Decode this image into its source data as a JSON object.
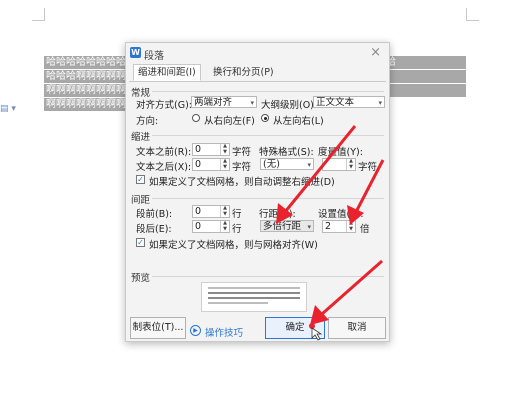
{
  "document": {
    "lines": [
      "哈哈哈哈哈哈哈哈哈哈哈哈哈哈哈哈哈哈哈哈哈哈哈哈哈哈哈哈哈哈哈哈哈哈哈",
      "哈哈哈啊啊啊啊啊啊啊啊啊啊啊啊啊啊啊啊啊啊啊啊啊啊啊啊哈哈哈哈哈哈哈",
      "啊啊啊啊啊啊啊啊啊啊啊啊啊啊啊啊啊啊啊啊啊啊啊啊啊哦哦或哦或哦或哦",
      "啊啊啊啊啊啊啊啊啊啊啊啊啊啊啊啊啊啊啊啊啊啊啊啊啊啊啊啊啊啊啊啊啊啊"
    ]
  },
  "dialog": {
    "title": "段落",
    "app_icon": "W",
    "tabs": [
      {
        "label": "缩进和间距(I)"
      },
      {
        "label": "换行和分页(P)"
      }
    ],
    "general": {
      "section": "常规",
      "alignment_label": "对齐方式(G):",
      "alignment_value": "两端对齐",
      "outline_label": "大纲级别(O):",
      "outline_value": "正文文本",
      "direction_label": "方向:",
      "rtl_label": "从右向左(F)",
      "ltr_label": "从左向右(L)"
    },
    "indent": {
      "section": "缩进",
      "before_label": "文本之前(R):",
      "before_value": "0",
      "before_unit": "字符",
      "after_label": "文本之后(X):",
      "after_value": "0",
      "after_unit": "字符",
      "special_label": "特殊格式(S):",
      "special_value": "(无)",
      "measure_label": "度量值(Y):",
      "measure_unit": "字符",
      "grid_check_label": "如果定义了文档网格，则自动调整右缩进(D)"
    },
    "spacing": {
      "section": "间距",
      "before_label": "段前(B):",
      "before_value": "0",
      "before_unit": "行",
      "after_label": "段后(E):",
      "after_value": "0",
      "after_unit": "行",
      "line_label": "行距(N):",
      "line_value": "多倍行距",
      "set_label": "设置值(A):",
      "set_value": "2",
      "set_unit": "倍",
      "grid_check_label": "如果定义了文档网格，则与网格对齐(W)"
    },
    "preview_label": "预览",
    "footer": {
      "tabs_button": "制表位(T)...",
      "tips_label": "操作技巧",
      "ok_button": "确定",
      "cancel_button": "取消"
    }
  },
  "colors": {
    "accent": "#2b76d2",
    "annotation_arrow": "#e8232e",
    "selection": "#a8a8a8"
  }
}
